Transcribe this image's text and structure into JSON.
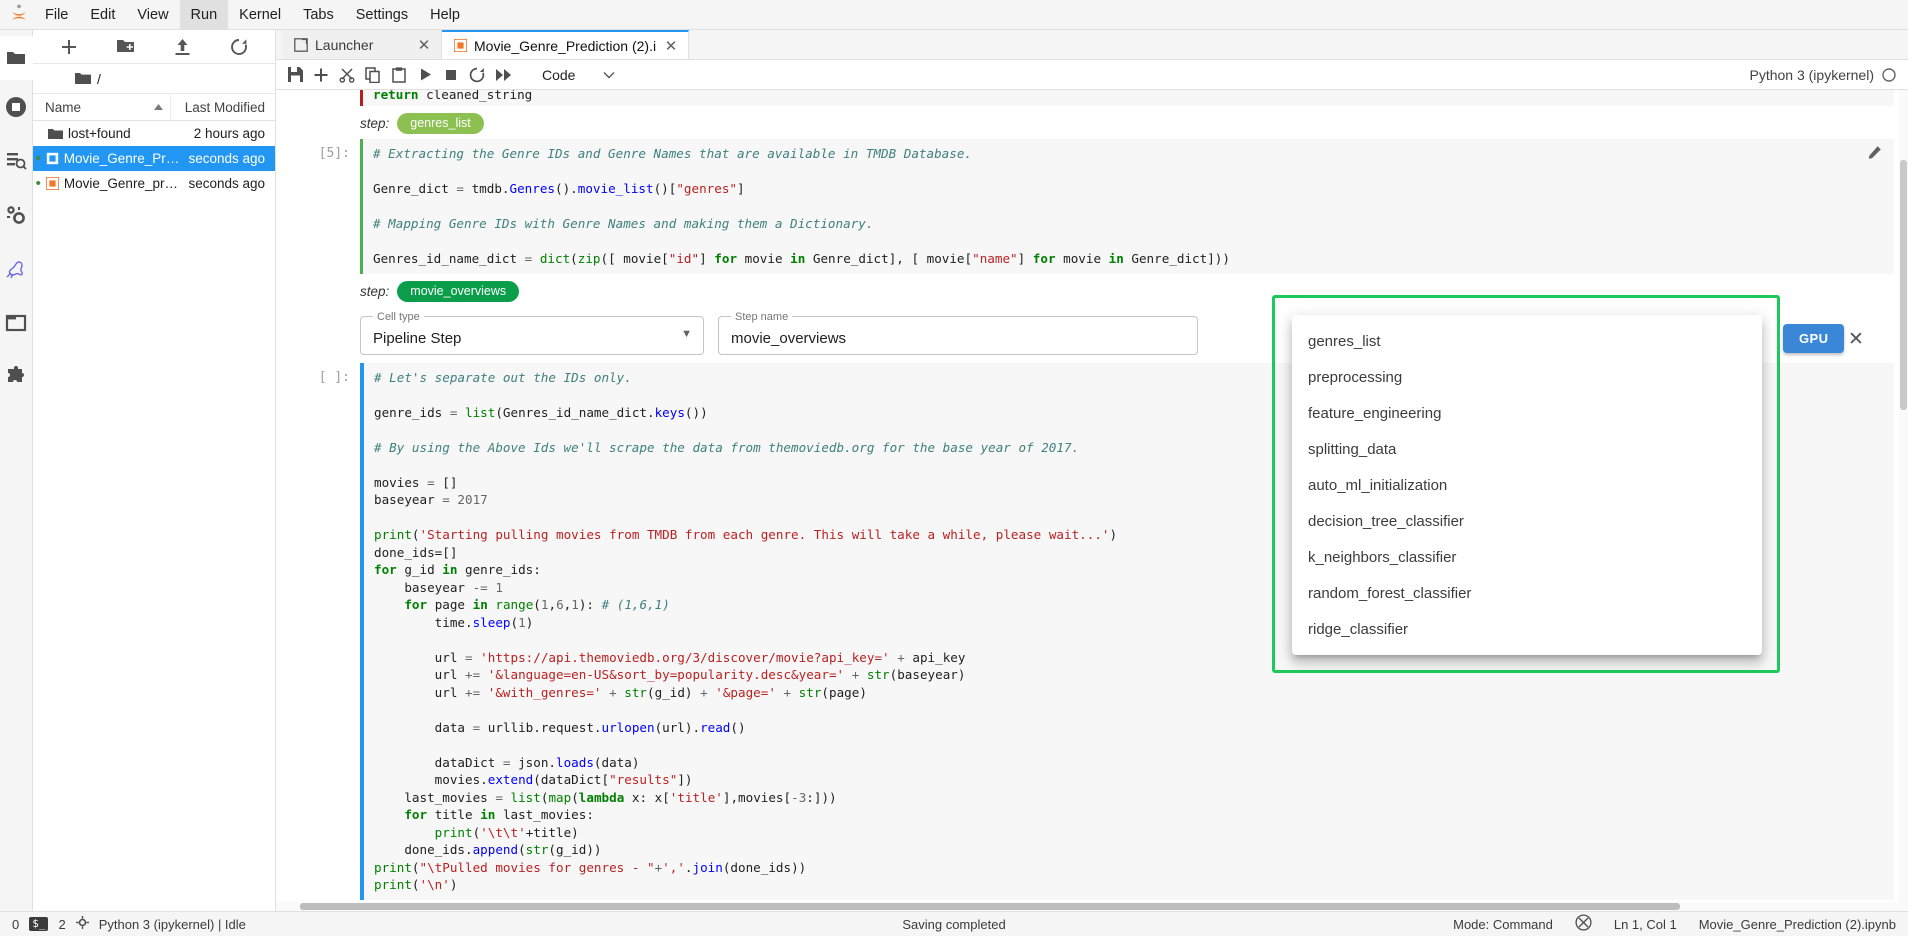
{
  "app": {
    "logo_icon": "jupyter-logo",
    "menu": [
      {
        "label": "File"
      },
      {
        "label": "Edit"
      },
      {
        "label": "View"
      },
      {
        "label": "Run",
        "active": true
      },
      {
        "label": "Kernel"
      },
      {
        "label": "Tabs"
      },
      {
        "label": "Settings"
      },
      {
        "label": "Help"
      }
    ]
  },
  "rail": {
    "top_icon": "folder-icon",
    "items": [
      {
        "icon": "running-terminals-icon",
        "name": "running-sessions"
      },
      {
        "icon": "table-of-contents-icon",
        "name": "table-of-contents"
      },
      {
        "icon": "gears-icon",
        "name": "property-inspector"
      },
      {
        "icon": "kangaroo-icon",
        "name": "kale-deployment-panel"
      },
      {
        "icon": "window-icon",
        "name": "open-tabs"
      },
      {
        "icon": "puzzle-icon",
        "name": "extension-manager"
      }
    ]
  },
  "filebrowser": {
    "toolbar": [
      {
        "icon": "plus-icon",
        "name": "new-launcher-button"
      },
      {
        "icon": "new-folder-icon",
        "name": "new-folder-button"
      },
      {
        "icon": "upload-icon",
        "name": "upload-button"
      },
      {
        "icon": "refresh-icon",
        "name": "refresh-button"
      }
    ],
    "breadcrumb_icon": "folder-icon",
    "breadcrumb": "/",
    "columns": {
      "name": "Name",
      "modified": "Last Modified"
    },
    "sort_icon": "caret-up-icon",
    "rows": [
      {
        "name": "lost+found",
        "modified": "2 hours ago",
        "icon": "folder-icon",
        "selected": false,
        "running": false
      },
      {
        "name": "Movie_Genre_Predic...",
        "modified": "seconds ago",
        "icon": "notebook-icon-blue",
        "selected": true,
        "running": true
      },
      {
        "name": "Movie_Genre_predic...",
        "modified": "seconds ago",
        "icon": "notebook-icon-orange",
        "selected": false,
        "running": true
      }
    ]
  },
  "tabs": [
    {
      "label": "Launcher",
      "icon": "launcher-icon",
      "active": false,
      "close_icon": "close-icon"
    },
    {
      "label": "Movie_Genre_Prediction (2).i",
      "icon": "notebook-icon-orange",
      "active": true,
      "close_icon": "close-icon"
    }
  ],
  "notebook_toolbar": {
    "buttons": [
      {
        "icon": "save-icon",
        "name": "save-button"
      },
      {
        "icon": "plus-icon",
        "name": "insert-cell-button"
      },
      {
        "icon": "scissors-icon",
        "name": "cut-cell-button"
      },
      {
        "icon": "copy-icon",
        "name": "copy-cell-button"
      },
      {
        "icon": "paste-icon",
        "name": "paste-cell-button"
      },
      {
        "icon": "play-icon",
        "name": "run-cell-button"
      },
      {
        "icon": "stop-icon",
        "name": "interrupt-kernel-button"
      },
      {
        "icon": "restart-icon",
        "name": "restart-kernel-button"
      },
      {
        "icon": "fast-forward-icon",
        "name": "restart-and-run-all-button"
      }
    ],
    "celltype_value": "Code",
    "celltype_caret": "chevron-down-icon",
    "kernel_name": "Python 3 (ipykernel)",
    "kernel_status_icon": "kernel-idle-circle"
  },
  "notebook": {
    "partial_top_line": "return cleaned_string",
    "cells": [
      {
        "step_label": "step:",
        "step_tag": "genres_list",
        "step_tag_color": "#8cc152",
        "prompt": "[5]:",
        "has_pencil": true,
        "lines": [
          [
            {
              "t": "# Extracting the Genre IDs and Genre Names that are available in TMDB Database.",
              "c": "cm"
            }
          ],
          [
            {
              "t": "",
              "c": ""
            }
          ],
          [
            {
              "t": "Genre_dict ",
              "c": ""
            },
            {
              "t": "= ",
              "c": "op"
            },
            {
              "t": "tmdb.",
              "c": ""
            },
            {
              "t": "Genres",
              "c": "fn"
            },
            {
              "t": "().",
              "c": ""
            },
            {
              "t": "movie_list",
              "c": "fn"
            },
            {
              "t": "()[",
              "c": ""
            },
            {
              "t": "\"genres\"",
              "c": "st"
            },
            {
              "t": "]",
              "c": ""
            }
          ],
          [
            {
              "t": "",
              "c": ""
            }
          ],
          [
            {
              "t": "# Mapping Genre IDs with Genre Names and making them a Dictionary.",
              "c": "cm"
            }
          ],
          [
            {
              "t": "",
              "c": ""
            }
          ],
          [
            {
              "t": "Genres_id_name_dict ",
              "c": ""
            },
            {
              "t": "= ",
              "c": "op"
            },
            {
              "t": "dict",
              "c": "bi"
            },
            {
              "t": "(",
              "c": ""
            },
            {
              "t": "zip",
              "c": "bi"
            },
            {
              "t": "([ movie[",
              "c": ""
            },
            {
              "t": "\"id\"",
              "c": "st"
            },
            {
              "t": "] ",
              "c": ""
            },
            {
              "t": "for ",
              "c": "kw"
            },
            {
              "t": "movie ",
              "c": ""
            },
            {
              "t": "in ",
              "c": "kw"
            },
            {
              "t": "Genre_dict], [ movie[",
              "c": ""
            },
            {
              "t": "\"name\"",
              "c": "st"
            },
            {
              "t": "] ",
              "c": ""
            },
            {
              "t": "for ",
              "c": "kw"
            },
            {
              "t": "movie ",
              "c": ""
            },
            {
              "t": "in ",
              "c": "kw"
            },
            {
              "t": "Genre_dict]))",
              "c": ""
            }
          ]
        ]
      },
      {
        "step_label": "step:",
        "step_tag": "movie_overviews",
        "step_tag_color": "#0a9e4a",
        "prompt": "[ ]:",
        "has_pencil": false,
        "lines": [
          [
            {
              "t": "# Let's separate out the IDs only.",
              "c": "cm"
            }
          ],
          [
            {
              "t": "",
              "c": ""
            }
          ],
          [
            {
              "t": "genre_ids ",
              "c": ""
            },
            {
              "t": "= ",
              "c": "op"
            },
            {
              "t": "list",
              "c": "bi"
            },
            {
              "t": "(Genres_id_name_dict.",
              "c": ""
            },
            {
              "t": "keys",
              "c": "fn"
            },
            {
              "t": "())",
              "c": ""
            }
          ],
          [
            {
              "t": "",
              "c": ""
            }
          ],
          [
            {
              "t": "# By using the Above Ids we'll scrape the data from themoviedb.org for the base year of 2017.",
              "c": "cm"
            }
          ],
          [
            {
              "t": "",
              "c": ""
            }
          ],
          [
            {
              "t": "movies ",
              "c": ""
            },
            {
              "t": "= ",
              "c": "op"
            },
            {
              "t": "[]",
              "c": ""
            }
          ],
          [
            {
              "t": "baseyear ",
              "c": ""
            },
            {
              "t": "= ",
              "c": "op"
            },
            {
              "t": "2017",
              "c": "nu"
            }
          ],
          [
            {
              "t": "",
              "c": ""
            }
          ],
          [
            {
              "t": "print",
              "c": "bi"
            },
            {
              "t": "(",
              "c": ""
            },
            {
              "t": "'Starting pulling movies from TMDB from each genre. This will take a while, please wait...'",
              "c": "st"
            },
            {
              "t": ")",
              "c": ""
            }
          ],
          [
            {
              "t": "done_ids=[]",
              "c": ""
            }
          ],
          [
            {
              "t": "for ",
              "c": "kw"
            },
            {
              "t": "g_id ",
              "c": ""
            },
            {
              "t": "in ",
              "c": "kw"
            },
            {
              "t": "genre_ids:",
              "c": ""
            }
          ],
          [
            {
              "t": "    baseyear ",
              "c": ""
            },
            {
              "t": "-= ",
              "c": "op"
            },
            {
              "t": "1",
              "c": "nu"
            }
          ],
          [
            {
              "t": "    ",
              "c": ""
            },
            {
              "t": "for ",
              "c": "kw"
            },
            {
              "t": "page ",
              "c": ""
            },
            {
              "t": "in ",
              "c": "kw"
            },
            {
              "t": "range",
              "c": "bi"
            },
            {
              "t": "(",
              "c": ""
            },
            {
              "t": "1",
              "c": "nu"
            },
            {
              "t": ",",
              "c": ""
            },
            {
              "t": "6",
              "c": "nu"
            },
            {
              "t": ",",
              "c": ""
            },
            {
              "t": "1",
              "c": "nu"
            },
            {
              "t": "): ",
              "c": ""
            },
            {
              "t": "# (1,6,1)",
              "c": "cm"
            }
          ],
          [
            {
              "t": "        time.",
              "c": ""
            },
            {
              "t": "sleep",
              "c": "fn"
            },
            {
              "t": "(",
              "c": ""
            },
            {
              "t": "1",
              "c": "nu"
            },
            {
              "t": ")",
              "c": ""
            }
          ],
          [
            {
              "t": "",
              "c": ""
            }
          ],
          [
            {
              "t": "        url ",
              "c": ""
            },
            {
              "t": "= ",
              "c": "op"
            },
            {
              "t": "'https://api.themoviedb.org/3/discover/movie?api_key=' ",
              "c": "st"
            },
            {
              "t": "+ ",
              "c": "op"
            },
            {
              "t": "api_key",
              "c": ""
            }
          ],
          [
            {
              "t": "        url ",
              "c": ""
            },
            {
              "t": "+= ",
              "c": "op"
            },
            {
              "t": "'&language=en-US&sort_by=popularity.desc&year=' ",
              "c": "st"
            },
            {
              "t": "+ ",
              "c": "op"
            },
            {
              "t": "str",
              "c": "bi"
            },
            {
              "t": "(baseyear)",
              "c": ""
            }
          ],
          [
            {
              "t": "        url ",
              "c": ""
            },
            {
              "t": "+= ",
              "c": "op"
            },
            {
              "t": "'&with_genres=' ",
              "c": "st"
            },
            {
              "t": "+ ",
              "c": "op"
            },
            {
              "t": "str",
              "c": "bi"
            },
            {
              "t": "(g_id) ",
              "c": ""
            },
            {
              "t": "+ ",
              "c": "op"
            },
            {
              "t": "'&page=' ",
              "c": "st"
            },
            {
              "t": "+ ",
              "c": "op"
            },
            {
              "t": "str",
              "c": "bi"
            },
            {
              "t": "(page)",
              "c": ""
            }
          ],
          [
            {
              "t": "",
              "c": ""
            }
          ],
          [
            {
              "t": "        data ",
              "c": ""
            },
            {
              "t": "= ",
              "c": "op"
            },
            {
              "t": "urllib.request.",
              "c": ""
            },
            {
              "t": "urlopen",
              "c": "fn"
            },
            {
              "t": "(url).",
              "c": ""
            },
            {
              "t": "read",
              "c": "fn"
            },
            {
              "t": "()",
              "c": ""
            }
          ],
          [
            {
              "t": "",
              "c": ""
            }
          ],
          [
            {
              "t": "        dataDict ",
              "c": ""
            },
            {
              "t": "= ",
              "c": "op"
            },
            {
              "t": "json.",
              "c": ""
            },
            {
              "t": "loads",
              "c": "fn"
            },
            {
              "t": "(data)",
              "c": ""
            }
          ],
          [
            {
              "t": "        movies.",
              "c": ""
            },
            {
              "t": "extend",
              "c": "fn"
            },
            {
              "t": "(dataDict[",
              "c": ""
            },
            {
              "t": "\"results\"",
              "c": "st"
            },
            {
              "t": "])",
              "c": ""
            }
          ],
          [
            {
              "t": "    last_movies ",
              "c": ""
            },
            {
              "t": "= ",
              "c": "op"
            },
            {
              "t": "list",
              "c": "bi"
            },
            {
              "t": "(",
              "c": ""
            },
            {
              "t": "map",
              "c": "bi"
            },
            {
              "t": "(",
              "c": ""
            },
            {
              "t": "lambda ",
              "c": "kw"
            },
            {
              "t": "x: x[",
              "c": ""
            },
            {
              "t": "'title'",
              "c": "st"
            },
            {
              "t": "],movies[",
              "c": ""
            },
            {
              "t": "-3",
              "c": "nu"
            },
            {
              "t": ":]))",
              "c": ""
            }
          ],
          [
            {
              "t": "    ",
              "c": ""
            },
            {
              "t": "for ",
              "c": "kw"
            },
            {
              "t": "title ",
              "c": ""
            },
            {
              "t": "in ",
              "c": "kw"
            },
            {
              "t": "last_movies:",
              "c": ""
            }
          ],
          [
            {
              "t": "        ",
              "c": ""
            },
            {
              "t": "print",
              "c": "bi"
            },
            {
              "t": "(",
              "c": ""
            },
            {
              "t": "'\\t\\t'",
              "c": "st"
            },
            {
              "t": "+title)",
              "c": ""
            }
          ],
          [
            {
              "t": "    done_ids.",
              "c": ""
            },
            {
              "t": "append",
              "c": "fn"
            },
            {
              "t": "(",
              "c": ""
            },
            {
              "t": "str",
              "c": "bi"
            },
            {
              "t": "(g_id))",
              "c": ""
            }
          ],
          [
            {
              "t": "print",
              "c": "bi"
            },
            {
              "t": "(",
              "c": ""
            },
            {
              "t": "\"\\tPulled movies for genres - \"",
              "c": "st"
            },
            {
              "t": "+",
              "c": "op"
            },
            {
              "t": "','",
              "c": "st"
            },
            {
              "t": ".",
              "c": ""
            },
            {
              "t": "join",
              "c": "fn"
            },
            {
              "t": "(done_ids))",
              "c": ""
            }
          ],
          [
            {
              "t": "print",
              "c": "bi"
            },
            {
              "t": "(",
              "c": ""
            },
            {
              "t": "'\\n'",
              "c": "st"
            },
            {
              "t": ")",
              "c": ""
            }
          ]
        ]
      }
    ]
  },
  "kale_form": {
    "celltype_legend": "Cell type",
    "celltype_value": "Pipeline Step",
    "celltype_caret_icon": "caret-down-icon",
    "stepname_legend": "Step name",
    "stepname_value": "movie_overviews",
    "gpu_button": "GPU",
    "close_icon": "close-icon"
  },
  "dropdown": {
    "highlight_color": "#1ec95c",
    "items": [
      "genres_list",
      "preprocessing",
      "feature_engineering",
      "splitting_data",
      "auto_ml_initialization",
      "decision_tree_classifier",
      "k_neighbors_classifier",
      "random_forest_classifier",
      "ridge_classifier"
    ]
  },
  "statusbar": {
    "terminals_count": "0",
    "kernel_chip_icon": "terminal-chip",
    "kernels_count": "2",
    "kernel_icon": "kernel-icon",
    "kernel_text": "Python 3 (ipykernel) | Idle",
    "saving_text": "Saving completed",
    "mode": "Mode: Command",
    "notifications_icon": "notification-muted-icon",
    "cursor_position": "Ln 1, Col 1",
    "filename": "Movie_Genre_Prediction (2).ipynb"
  }
}
